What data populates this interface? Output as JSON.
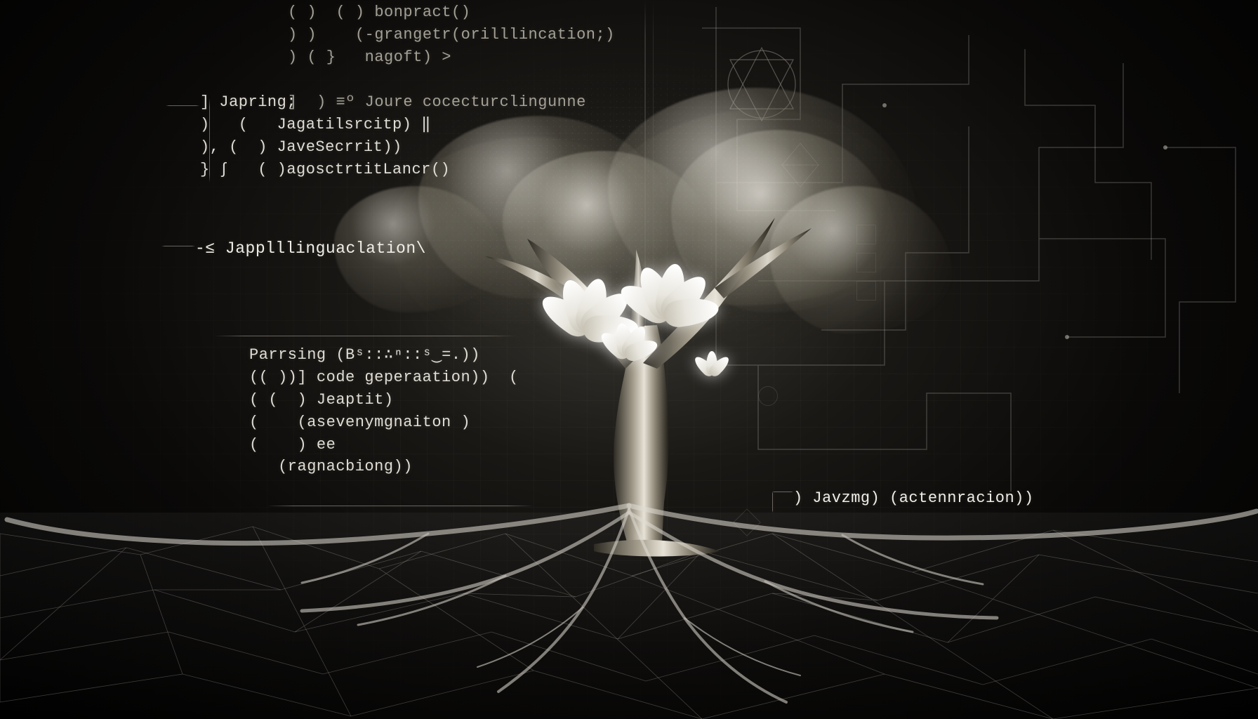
{
  "code_top": {
    "line1": "( )  ( ) bonpract()",
    "line2": ") )    (-grangetr(orilllincation;)",
    "line3": ") ( }   nagoft) >",
    "line4": "",
    "line5": "]  ) ≡º Joure cocecturclingunne"
  },
  "code_japring": {
    "head": "] Japring;",
    "l1": ")   (   Jagatilsrcitp) ‖",
    "l2": "), (  ) JaveSecrrit))",
    "l3": "} ∫   ( )agosctrtitLancr()"
  },
  "code_middle": {
    "label": "-≤ Japplllinguaclation\\"
  },
  "code_box": {
    "l1": "Parrsing (Bˢ::∴ⁿ::ˢ‿=.))",
    "l2": "(( ))] code geperaation))  (",
    "l3": "( (  ) Jeaptit)",
    "l4": "(    (asevenymgnaiton )",
    "l5": "(    ) ee",
    "l6": "   (ragnacbiong))"
  },
  "code_right": {
    "l1": ") Javzmg) (actennracion))"
  }
}
